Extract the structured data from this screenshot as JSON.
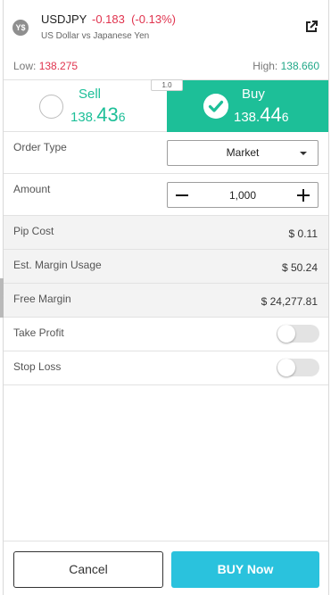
{
  "header": {
    "symbol_icon": "Y$",
    "symbol": "USDJPY",
    "change": "-0.183",
    "change_pct": "(-0.13%)",
    "description": "US Dollar vs Japanese Yen",
    "external_icon": "external-link-icon",
    "low_label": "Low:",
    "low_value": "138.275",
    "high_label": "High:",
    "high_value": "138.660"
  },
  "spread": "1.0",
  "sell": {
    "label": "Sell",
    "price_prefix": "138.",
    "price_big": "43",
    "price_suffix": "6"
  },
  "buy": {
    "label": "Buy",
    "price_prefix": "138.",
    "price_big": "44",
    "price_suffix": "6"
  },
  "order_type": {
    "label": "Order Type",
    "value": "Market"
  },
  "amount": {
    "label": "Amount",
    "value": "1,000"
  },
  "pip_cost": {
    "label": "Pip Cost",
    "value": "$ 0.11"
  },
  "margin_usage": {
    "label": "Est. Margin Usage",
    "value": "$ 50.24"
  },
  "free_margin": {
    "label": "Free Margin",
    "value": "$ 24,277.81"
  },
  "take_profit": {
    "label": "Take Profit",
    "enabled": false
  },
  "stop_loss": {
    "label": "Stop Loss",
    "enabled": false
  },
  "footer": {
    "cancel_label": "Cancel",
    "buy_label": "BUY Now"
  },
  "colors": {
    "buy_green": "#1dbf98",
    "negative_red": "#e0334e",
    "buy_now_cyan": "#2ac2dd"
  }
}
